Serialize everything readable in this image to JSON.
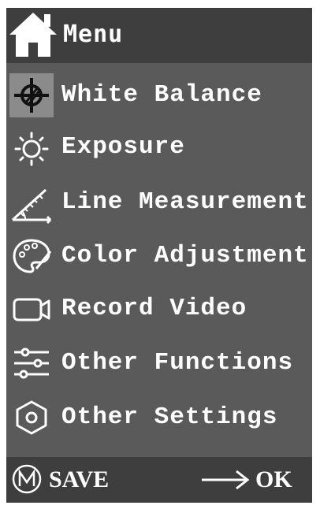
{
  "header": {
    "title": "Menu",
    "icon": "home-icon"
  },
  "menu": {
    "items": [
      {
        "label": "White Balance",
        "icon": "white-balance-icon",
        "selected": true
      },
      {
        "label": "Exposure",
        "icon": "sun-icon",
        "selected": false
      },
      {
        "label": "Line Measurement",
        "icon": "ruler-icon",
        "selected": false
      },
      {
        "label": "Color Adjustment",
        "icon": "palette-icon",
        "selected": false
      },
      {
        "label": "Record Video",
        "icon": "video-camera-icon",
        "selected": false
      },
      {
        "label": "Other Functions",
        "icon": "sliders-icon",
        "selected": false
      },
      {
        "label": "Other Settings",
        "icon": "hexagon-settings-icon",
        "selected": false
      }
    ]
  },
  "footer": {
    "save_label": "SAVE",
    "ok_label": "OK",
    "save_icon": "m-circle-icon",
    "ok_icon": "right-arrow-icon"
  },
  "colors": {
    "screen_bg": "#5a5a5a",
    "bar_bg": "#3e3e3e",
    "selected_bg": "#8b8b8b",
    "text": "#ffffff"
  }
}
